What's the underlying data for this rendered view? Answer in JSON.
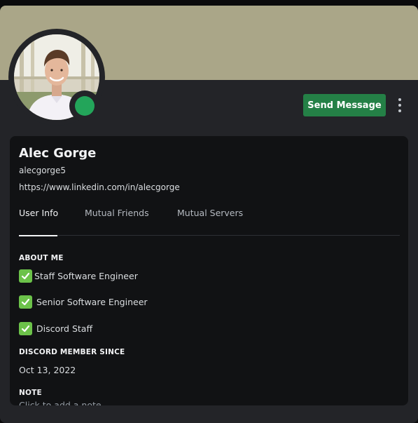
{
  "colors": {
    "banner": "#aaa688",
    "card_bg": "#232428",
    "inner_bg": "#111214",
    "status_online": "#23a55a",
    "button_green": "#248046",
    "check_green": "#6cc24a"
  },
  "profile": {
    "display_name": "Alec Gorge",
    "username": "alecgorge5",
    "link": "https://www.linkedin.com/in/alecgorge",
    "status": "online",
    "avatar_icon": "profile-photo"
  },
  "actions": {
    "send_message_label": "Send Message",
    "more_icon": "vertical-ellipsis-icon"
  },
  "tabs": [
    {
      "label": "User Info",
      "active": true
    },
    {
      "label": "Mutual Friends",
      "active": false
    },
    {
      "label": "Mutual Servers",
      "active": false
    }
  ],
  "about_me": {
    "heading": "ABOUT ME",
    "lines": [
      {
        "icon": "check-mark-icon",
        "text": "Staff Software Engineer"
      },
      {
        "icon": "check-mark-icon",
        "text": "Senior Software Engineer"
      },
      {
        "icon": "check-mark-icon",
        "text": "Discord Staff"
      }
    ]
  },
  "member_since": {
    "heading": "DISCORD MEMBER SINCE",
    "date": "Oct 13, 2022"
  },
  "note": {
    "heading": "NOTE",
    "placeholder": "Click to add a note"
  }
}
